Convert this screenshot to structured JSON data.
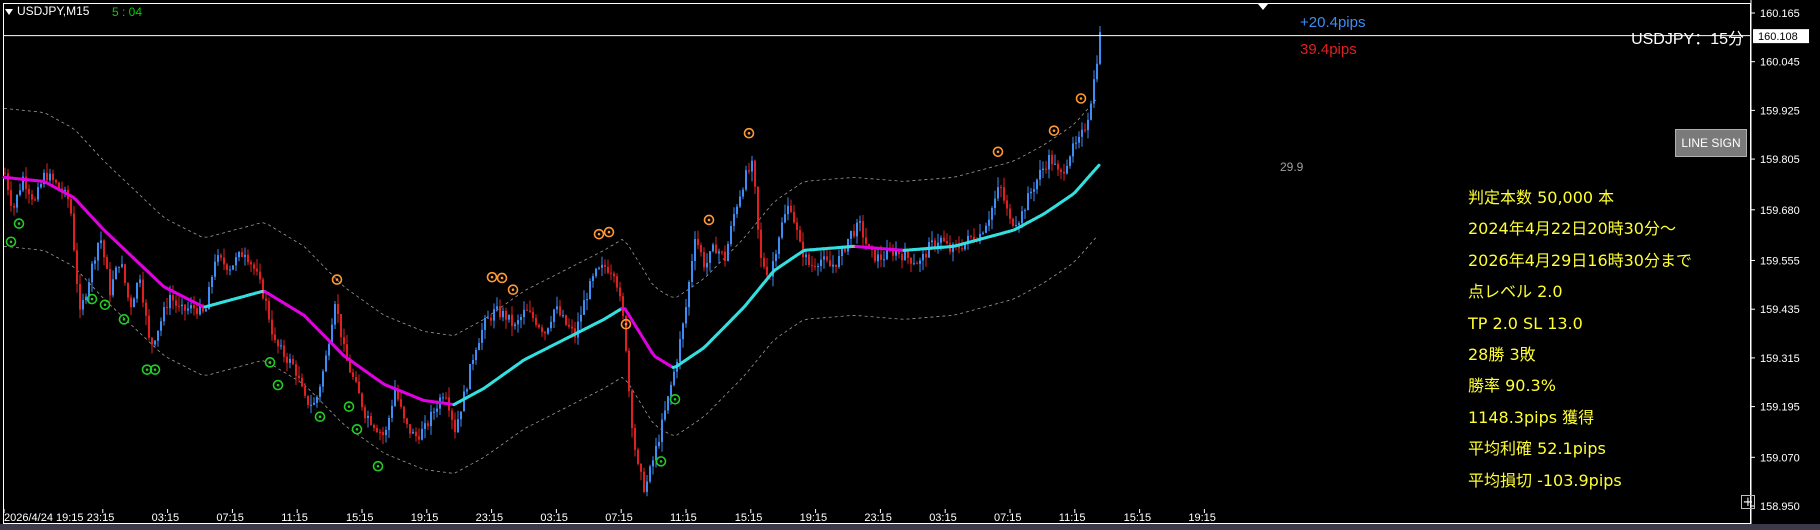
{
  "header": {
    "symbol_tf": "USDJPY,M15",
    "timer": "5 : 04",
    "title": "USDJPY：15分"
  },
  "pips": {
    "gain": "+20.4pips",
    "loss": "39.4pips"
  },
  "line_sign_button": "LINE SIGN",
  "band_value_label": "29.9",
  "stats": [
    "判定本数 50,000 本",
    "2024年4月22日20時30分〜",
    "2026年4月29日16時30分まで",
    "点レベル 2.0",
    "TP 2.0 SL 13.0",
    "28勝 3敗",
    "勝率 90.3%",
    "1148.3pips 獲得",
    "平均利確 52.1pips",
    "平均損切 -103.9pips"
  ],
  "colors": {
    "bull": "#3d8df5",
    "bear": "#e02020",
    "ma_down": "#e000e0",
    "ma_up": "#33e0e0",
    "signal_buy": "#22cc22",
    "signal_sell": "#ff9933",
    "stats_text": "#ffff33"
  },
  "chart_data": {
    "type": "candlestick",
    "symbol": "USDJPY",
    "timeframe": "M15",
    "current_price": "160.108",
    "y_ticks": [
      "160.165",
      "160.045",
      "159.925",
      "159.805",
      "159.680",
      "159.555",
      "159.435",
      "159.315",
      "159.195",
      "159.070",
      "158.950"
    ],
    "y_tick_values": [
      160.165,
      160.045,
      159.925,
      159.805,
      159.68,
      159.555,
      159.435,
      159.315,
      159.195,
      159.07,
      158.95
    ],
    "ylim": [
      158.93,
      160.19
    ],
    "x_ticks": [
      "2026/4/24 19:15",
      "23:15",
      "03:15",
      "07:15",
      "11:15",
      "15:15",
      "19:15",
      "23:15",
      "03:15",
      "07:15",
      "11:15",
      "15:15",
      "19:15",
      "23:15",
      "03:15",
      "07:15",
      "11:15",
      "15:15",
      "19:15"
    ],
    "price_path": [
      [
        0,
        159.77
      ],
      [
        8,
        159.68
      ],
      [
        18,
        159.76
      ],
      [
        30,
        159.7
      ],
      [
        40,
        159.77
      ],
      [
        52,
        159.74
      ],
      [
        65,
        159.7
      ],
      [
        75,
        159.42
      ],
      [
        85,
        159.52
      ],
      [
        95,
        159.62
      ],
      [
        105,
        159.48
      ],
      [
        115,
        159.56
      ],
      [
        125,
        159.44
      ],
      [
        135,
        159.52
      ],
      [
        145,
        159.34
      ],
      [
        155,
        159.4
      ],
      [
        165,
        159.47
      ],
      [
        175,
        159.43
      ],
      [
        190,
        159.44
      ],
      [
        200,
        159.42
      ],
      [
        210,
        159.56
      ],
      [
        225,
        159.54
      ],
      [
        240,
        159.58
      ],
      [
        250,
        159.53
      ],
      [
        260,
        159.46
      ],
      [
        270,
        159.35
      ],
      [
        280,
        159.32
      ],
      [
        290,
        159.29
      ],
      [
        300,
        159.21
      ],
      [
        310,
        159.2
      ],
      [
        320,
        159.3
      ],
      [
        330,
        159.46
      ],
      [
        340,
        159.32
      ],
      [
        350,
        159.25
      ],
      [
        360,
        159.18
      ],
      [
        370,
        159.15
      ],
      [
        380,
        159.12
      ],
      [
        390,
        159.24
      ],
      [
        400,
        159.15
      ],
      [
        410,
        159.12
      ],
      [
        420,
        159.14
      ],
      [
        430,
        159.19
      ],
      [
        440,
        159.24
      ],
      [
        450,
        159.14
      ],
      [
        460,
        159.23
      ],
      [
        470,
        159.34
      ],
      [
        480,
        159.4
      ],
      [
        490,
        159.43
      ],
      [
        500,
        159.42
      ],
      [
        510,
        159.39
      ],
      [
        520,
        159.43
      ],
      [
        530,
        159.41
      ],
      [
        540,
        159.38
      ],
      [
        550,
        159.44
      ],
      [
        560,
        159.4
      ],
      [
        570,
        159.37
      ],
      [
        580,
        159.46
      ],
      [
        590,
        159.52
      ],
      [
        600,
        159.54
      ],
      [
        610,
        159.53
      ],
      [
        620,
        159.38
      ],
      [
        625,
        159.2
      ],
      [
        632,
        159.05
      ],
      [
        640,
        158.99
      ],
      [
        650,
        159.08
      ],
      [
        660,
        159.18
      ],
      [
        670,
        159.29
      ],
      [
        680,
        159.42
      ],
      [
        690,
        159.62
      ],
      [
        700,
        159.54
      ],
      [
        710,
        159.59
      ],
      [
        720,
        159.56
      ],
      [
        730,
        159.68
      ],
      [
        740,
        159.76
      ],
      [
        748,
        159.79
      ],
      [
        755,
        159.56
      ],
      [
        765,
        159.52
      ],
      [
        775,
        159.63
      ],
      [
        785,
        159.7
      ],
      [
        795,
        159.59
      ],
      [
        805,
        159.54
      ],
      [
        815,
        159.56
      ],
      [
        825,
        159.54
      ],
      [
        835,
        159.56
      ],
      [
        845,
        159.62
      ],
      [
        855,
        159.64
      ],
      [
        865,
        159.57
      ],
      [
        875,
        159.56
      ],
      [
        890,
        159.58
      ],
      [
        905,
        159.56
      ],
      [
        915,
        159.55
      ],
      [
        925,
        159.59
      ],
      [
        935,
        159.61
      ],
      [
        945,
        159.58
      ],
      [
        955,
        159.59
      ],
      [
        965,
        159.61
      ],
      [
        975,
        159.62
      ],
      [
        985,
        159.67
      ],
      [
        995,
        159.74
      ],
      [
        1005,
        159.65
      ],
      [
        1015,
        159.66
      ],
      [
        1025,
        159.72
      ],
      [
        1035,
        159.77
      ],
      [
        1045,
        159.81
      ],
      [
        1055,
        159.76
      ],
      [
        1065,
        159.82
      ],
      [
        1075,
        159.85
      ],
      [
        1082,
        159.9
      ],
      [
        1088,
        159.98
      ],
      [
        1095,
        160.11
      ]
    ],
    "ma_path": [
      [
        0,
        159.76
      ],
      [
        40,
        159.75
      ],
      [
        70,
        159.71
      ],
      [
        100,
        159.63
      ],
      [
        130,
        159.56
      ],
      [
        160,
        159.49
      ],
      [
        200,
        159.44
      ],
      [
        230,
        159.46
      ],
      [
        260,
        159.48
      ],
      [
        300,
        159.42
      ],
      [
        340,
        159.32
      ],
      [
        380,
        159.25
      ],
      [
        420,
        159.21
      ],
      [
        450,
        159.2
      ],
      [
        480,
        159.24
      ],
      [
        520,
        159.31
      ],
      [
        560,
        159.36
      ],
      [
        600,
        159.41
      ],
      [
        620,
        159.44
      ],
      [
        650,
        159.32
      ],
      [
        670,
        159.29
      ],
      [
        700,
        159.34
      ],
      [
        740,
        159.44
      ],
      [
        770,
        159.53
      ],
      [
        800,
        159.58
      ],
      [
        850,
        159.59
      ],
      [
        900,
        159.58
      ],
      [
        950,
        159.59
      ],
      [
        980,
        159.61
      ],
      [
        1010,
        159.63
      ],
      [
        1040,
        159.67
      ],
      [
        1070,
        159.72
      ],
      [
        1095,
        159.79
      ]
    ],
    "buy_signals_x": [
      7,
      15,
      88,
      101,
      120,
      143,
      151,
      266,
      274,
      316,
      345,
      353,
      374,
      657,
      671
    ],
    "sell_signals_x": [
      333,
      488,
      498,
      509,
      595,
      605,
      622,
      705,
      745,
      994,
      1050,
      1077
    ],
    "band_width": 0.17
  }
}
